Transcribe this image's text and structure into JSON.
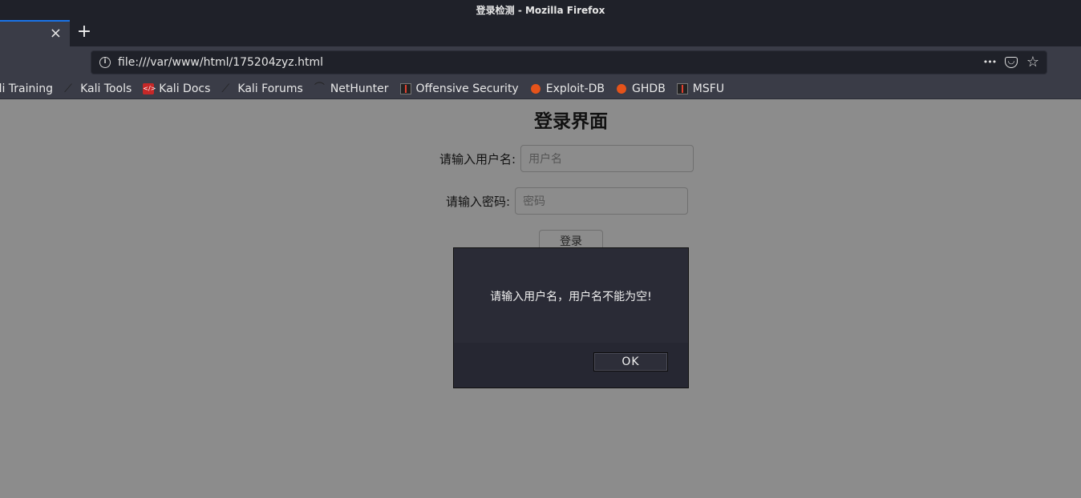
{
  "window": {
    "title": "登录检测 - Mozilla Firefox"
  },
  "tabs": {
    "close_glyph": "×",
    "new_tab_glyph": "+"
  },
  "navbar": {
    "url": "file:///var/www/html/175204zyz.html",
    "info_glyph": "i",
    "more_glyph": "•••",
    "pocket_glyph": "◡",
    "star_glyph": "☆"
  },
  "bookmarks": [
    {
      "label": "ali Training",
      "icon": "none"
    },
    {
      "label": "Kali Tools",
      "icon": "kali-dragon-icon"
    },
    {
      "label": "Kali Docs",
      "icon": "kali-docs-icon"
    },
    {
      "label": "Kali Forums",
      "icon": "kali-dragon-icon"
    },
    {
      "label": "NetHunter",
      "icon": "nethunter-icon"
    },
    {
      "label": "Offensive Security",
      "icon": "offsec-icon"
    },
    {
      "label": "Exploit-DB",
      "icon": "exploit-db-icon"
    },
    {
      "label": "GHDB",
      "icon": "exploit-db-icon"
    },
    {
      "label": "MSFU",
      "icon": "offsec-icon"
    }
  ],
  "page": {
    "title": "登录界面",
    "username_label": "请输入用户名:",
    "username_placeholder": "用户名",
    "password_label": "请输入密码:",
    "password_placeholder": "密码",
    "login_button": "登录"
  },
  "dialog": {
    "message": "请输入用户名，用户名不能为空!",
    "ok_label": "OK"
  }
}
